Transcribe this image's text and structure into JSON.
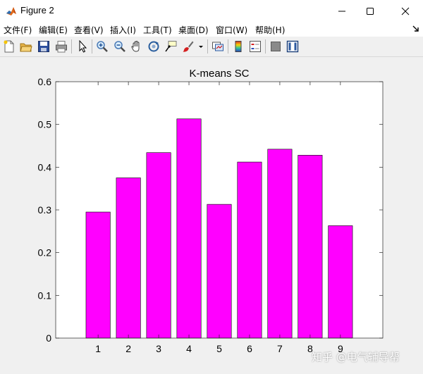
{
  "window": {
    "title": "Figure 2"
  },
  "menubar": {
    "items": [
      "文件(F)",
      "编辑(E)",
      "查看(V)",
      "插入(I)",
      "工具(T)",
      "桌面(D)",
      "窗口(W)",
      "帮助(H)"
    ]
  },
  "toolbar": {
    "icons": [
      "new-figure-icon",
      "open-file-icon",
      "save-icon",
      "print-icon",
      "pointer-icon",
      "zoom-in-icon",
      "zoom-out-icon",
      "pan-icon",
      "rotate-3d-icon",
      "data-cursor-icon",
      "brush-icon",
      "brush-dropdown-icon",
      "link-plot-icon",
      "colorbar-icon",
      "legend-icon",
      "hide-plot-tools-icon",
      "show-plot-tools-icon"
    ]
  },
  "chart_data": {
    "type": "bar",
    "title": "K-means SC",
    "xlabel": "",
    "ylabel": "",
    "categories": [
      "1",
      "2",
      "3",
      "4",
      "5",
      "6",
      "7",
      "8",
      "9"
    ],
    "values": [
      0.295,
      0.375,
      0.434,
      0.513,
      0.313,
      0.412,
      0.442,
      0.428,
      0.263
    ],
    "ylim": [
      0,
      0.6
    ],
    "yticks": [
      "0",
      "0.1",
      "0.2",
      "0.3",
      "0.4",
      "0.5",
      "0.6"
    ],
    "bar_color": "#ff00ff",
    "grid": false
  },
  "watermark": "知乎 @电气辅导帮"
}
